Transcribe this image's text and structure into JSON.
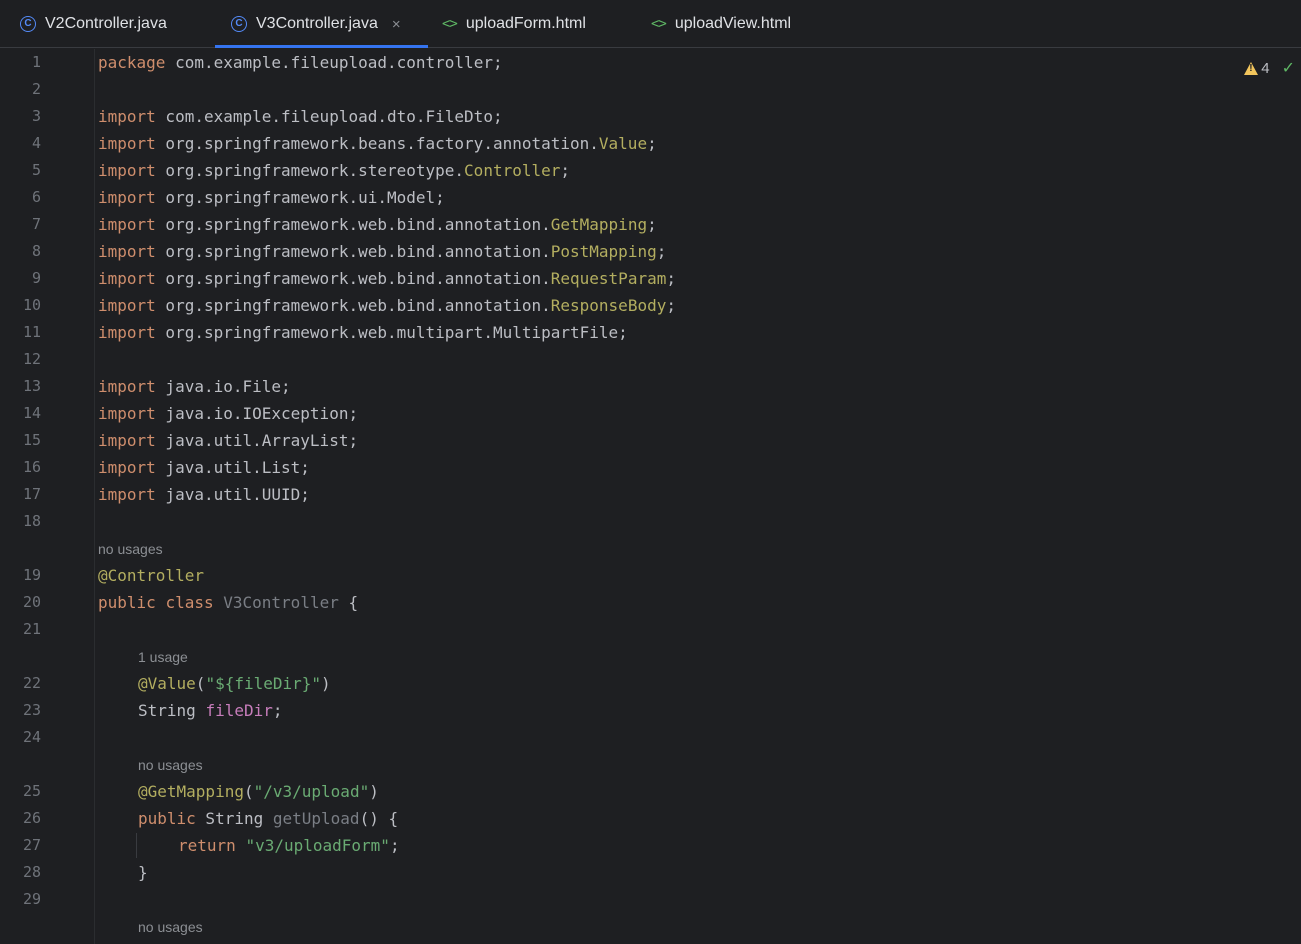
{
  "tabs": [
    {
      "label": "V2Controller.java",
      "icon": "class-icon"
    },
    {
      "label": "V3Controller.java",
      "icon": "class-icon",
      "active": true
    },
    {
      "label": "uploadForm.html",
      "icon": "html-icon"
    },
    {
      "label": "uploadView.html",
      "icon": "html-icon"
    }
  ],
  "tab_icons": {
    "class_glyph": "C",
    "html_glyph": "<>",
    "close_glyph": "×"
  },
  "inspections": {
    "warning_count": "4",
    "check_glyph": "✓"
  },
  "lines": {
    "l1": "1",
    "l2": "2",
    "l3": "3",
    "l4": "4",
    "l5": "5",
    "l6": "6",
    "l7": "7",
    "l8": "8",
    "l9": "9",
    "l10": "10",
    "l11": "11",
    "l12": "12",
    "l13": "13",
    "l14": "14",
    "l15": "15",
    "l16": "16",
    "l17": "17",
    "l18": "18",
    "l19": "19",
    "l20": "20",
    "l21": "21",
    "l22": "22",
    "l23": "23",
    "l24": "24",
    "l25": "25",
    "l26": "26",
    "l27": "27",
    "l28": "28",
    "l29": "29"
  },
  "code": {
    "kw_package": "package",
    "package_name": " com.example.fileupload.controller;",
    "kw_import": "import",
    "i3": " com.example.fileupload.dto.FileDto;",
    "i4_pre": " org.springframework.beans.factory.annotation.",
    "i4_cls": "Value",
    "i5_pre": " org.springframework.stereotype.",
    "i5_cls": "Controller",
    "i6": " org.springframework.ui.Model;",
    "i7_pre": " org.springframework.web.bind.annotation.",
    "i7_cls": "GetMapping",
    "i8_pre": " org.springframework.web.bind.annotation.",
    "i8_cls": "PostMapping",
    "i9_pre": " org.springframework.web.bind.annotation.",
    "i9_cls": "RequestParam",
    "i10_pre": " org.springframework.web.bind.annotation.",
    "i10_cls": "ResponseBody",
    "i11": " org.springframework.web.multipart.MultipartFile;",
    "i13": " java.io.File;",
    "i14": " java.io.IOException;",
    "i15": " java.util.ArrayList;",
    "i16": " java.util.List;",
    "i17": " java.util.UUID;",
    "semi": ";",
    "hint_no_usages": "no usages",
    "hint_one_usage": "1 usage",
    "a19": "@Controller",
    "kw_public": "public",
    "kw_class": "class",
    "class_name": "V3Controller",
    "open_brace": " {",
    "a22": "@Value",
    "a22_open": "(",
    "a22_str": "\"${fileDir}\"",
    "a22_close": ")",
    "t23": "String ",
    "f23": "fileDir",
    "a25": "@GetMapping",
    "a25_str": "\"/v3/upload\"",
    "m26_type": " String ",
    "m26_name": "getUpload",
    "m26_rest": "() {",
    "kw_return": "return",
    "r27_str": "\"v3/uploadForm\"",
    "close_brace": "}"
  },
  "colors": {
    "background": "#1e1f22",
    "keyword": "#cf8e6d",
    "annotation": "#b3ae60",
    "string": "#6aab73",
    "field": "#c77dbb",
    "accent": "#3574f0"
  }
}
